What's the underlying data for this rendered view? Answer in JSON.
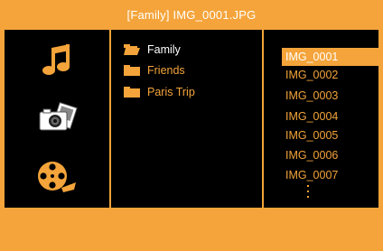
{
  "header": {
    "title": "[Family]   IMG_0001.JPG"
  },
  "categories": [
    {
      "name": "music",
      "icon": "music-note-icon"
    },
    {
      "name": "photo",
      "icon": "camera-icon"
    },
    {
      "name": "video",
      "icon": "film-reel-icon"
    }
  ],
  "folders": [
    {
      "label": "Family",
      "active": true,
      "icon": "folder-open-icon"
    },
    {
      "label": "Friends",
      "active": false,
      "icon": "folder-icon"
    },
    {
      "label": "Paris Trip",
      "active": false,
      "icon": "folder-icon"
    }
  ],
  "files": [
    {
      "label": "IMG_0001",
      "selected": true
    },
    {
      "label": "IMG_0002",
      "selected": false
    },
    {
      "label": "IMG_0003",
      "selected": false
    },
    {
      "label": "IMG_0004",
      "selected": false
    },
    {
      "label": "IMG_0005",
      "selected": false
    },
    {
      "label": "IMG_0006",
      "selected": false
    },
    {
      "label": "IMG_0007",
      "selected": false
    }
  ],
  "colors": {
    "accent": "#f4a43a",
    "panel": "#000000",
    "text_active": "#ffffff"
  }
}
